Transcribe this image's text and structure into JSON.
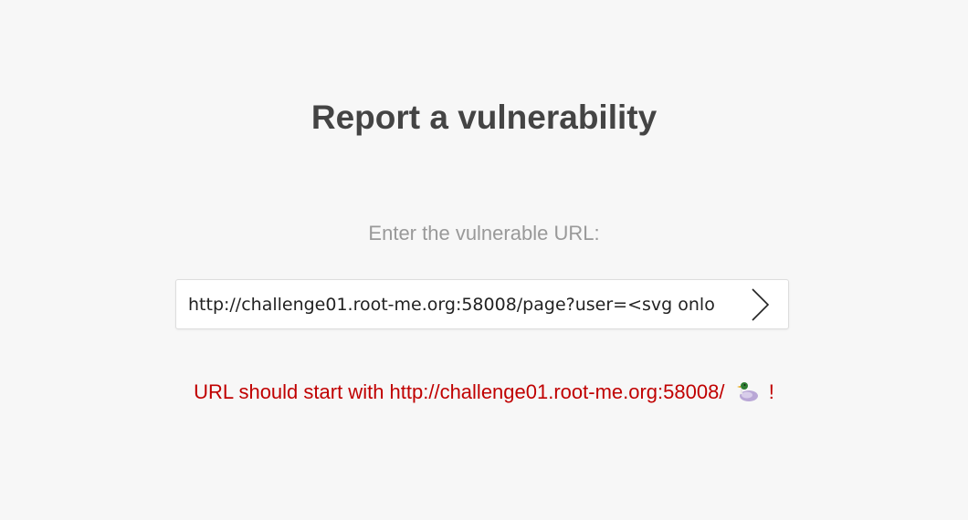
{
  "page": {
    "title": "Report a vulnerability",
    "prompt": "Enter the vulnerable URL:"
  },
  "form": {
    "url_value": "http://challenge01.root-me.org:58008/page?user=<svg onlo",
    "submit_icon": "chevron-right-icon"
  },
  "error": {
    "message": "URL should start with http://challenge01.root-me.org:58008/",
    "emoji_icon": "duck-icon",
    "suffix": "!",
    "color": "#c00000"
  },
  "colors": {
    "background": "#f7f7f7",
    "title": "#444444",
    "prompt": "#999999"
  }
}
